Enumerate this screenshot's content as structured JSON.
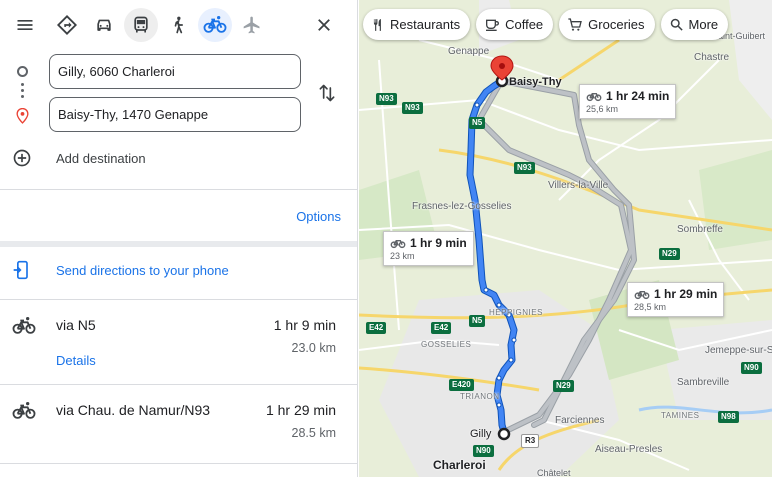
{
  "travel_modes": [
    {
      "name": "best-mode"
    },
    {
      "name": "driving"
    },
    {
      "name": "transit"
    },
    {
      "name": "walking"
    },
    {
      "name": "cycling"
    },
    {
      "name": "flights"
    }
  ],
  "search": {
    "origin": "Gilly, 6060 Charleroi",
    "destination": "Baisy-Thy, 1470 Genappe",
    "add_destination": "Add destination"
  },
  "options_label": "Options",
  "send_directions": "Send directions to your phone",
  "routes": [
    {
      "via": "via N5",
      "time": "1 hr 9 min",
      "distance": "23.0 km",
      "details": "Details"
    },
    {
      "via": "via Chau. de Namur/N93",
      "time": "1 hr 29 min",
      "distance": "28.5 km"
    }
  ],
  "map_chips": [
    {
      "label": "Restaurants",
      "icon": "restaurant-icon"
    },
    {
      "label": "Coffee",
      "icon": "coffee-icon"
    },
    {
      "label": "Groceries",
      "icon": "cart-icon"
    },
    {
      "label": "More",
      "icon": "search-icon"
    }
  ],
  "map": {
    "places": {
      "genappe": "Genappe",
      "baisy_thy": "Baisy-Thy",
      "chastre": "Chastre",
      "mont_saint_guibert": "Mont-Saint-Guibert",
      "villers": "Villers-la-Ville",
      "frasnes": "Frasnes-lez-Gosselies",
      "sombreffe": "Sombreffe",
      "heppignies": "HEPPIGNIES",
      "gosselies": "GOSSELIES",
      "jemeppe": "Jemeppe-sur-S",
      "sambreville": "Sambreville",
      "trianon": "TRIANON",
      "tamines": "TAMINES",
      "gilly": "Gilly",
      "farciennes": "Farciennes",
      "aiseau": "Aiseau-Presles",
      "charleroi": "Charleroi",
      "chatelet": "Châtelet"
    },
    "shields": [
      "N93",
      "N5",
      "N93",
      "N29",
      "E42",
      "N29",
      "E420",
      "N90",
      "N98",
      "N90",
      "R3",
      "N5"
    ],
    "callouts": [
      {
        "time": "1 hr 24 min",
        "distance": "25,6 km"
      },
      {
        "time": "1 hr 9 min",
        "distance": "23 km"
      },
      {
        "time": "1 hr 29 min",
        "distance": "28,5 km"
      }
    ]
  },
  "colors": {
    "accent": "#1a73e8",
    "route_primary": "#1a73e8",
    "route_alt": "#b0b5ba",
    "destination_pin": "#ea4335"
  }
}
